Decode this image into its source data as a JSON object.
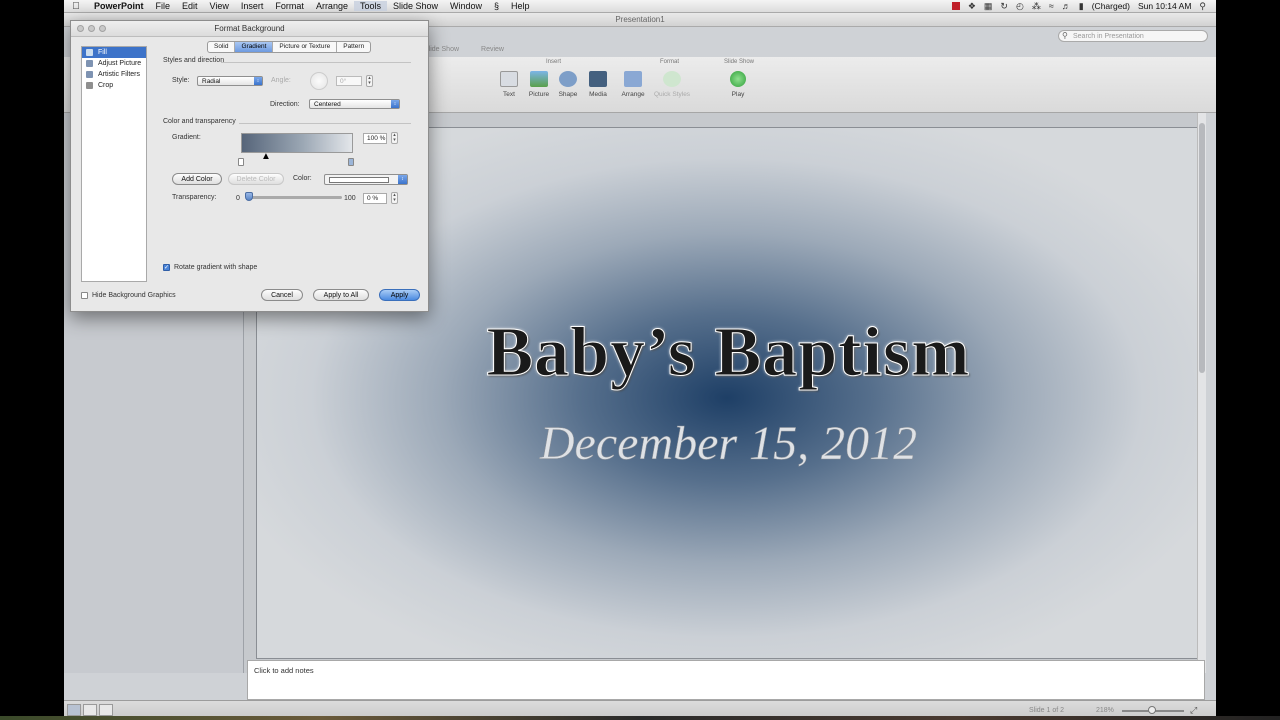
{
  "menubar": {
    "app": "PowerPoint",
    "items": [
      "File",
      "Edit",
      "View",
      "Insert",
      "Format",
      "Arrange",
      "Tools",
      "Slide Show",
      "Window",
      "Help"
    ],
    "selected": "Tools",
    "battery": "(Charged)",
    "clock": "Sun 10:14 AM"
  },
  "window": {
    "title": "Presentation1",
    "search_placeholder": "Search in Presentation",
    "ribbon_tabs": [
      "Slide Show",
      "Review"
    ],
    "groups": {
      "insert": "Insert",
      "format": "Format",
      "slideshow": "Slide Show"
    },
    "buttons": {
      "text": "Text",
      "picture": "Picture",
      "shape": "Shape",
      "media": "Media",
      "arrange": "Arrange",
      "quick_styles": "Quick Styles",
      "play": "Play"
    }
  },
  "slide": {
    "title": "Baby’s Baptism",
    "subtitle": "December 15, 2012",
    "gradient_center": "#1e3f66",
    "gradient_edge": "#d6d9dc"
  },
  "notes": {
    "placeholder": "Click to add notes"
  },
  "status": {
    "slide": "Slide 1 of 2",
    "zoom": "218%"
  },
  "dialog": {
    "title": "Format Background",
    "categories": [
      "Fill",
      "Adjust Picture",
      "Artistic Filters",
      "Crop"
    ],
    "selected_category": "Fill",
    "tabs": [
      "Solid",
      "Gradient",
      "Picture or Texture",
      "Pattern"
    ],
    "selected_tab": "Gradient",
    "styles_section": "Styles and direction",
    "style_label": "Style:",
    "style_value": "Radial",
    "angle_label": "Angle:",
    "angle_value": "0°",
    "direction_label": "Direction:",
    "direction_value": "Centered",
    "color_section": "Color and transparency",
    "gradient_label": "Gradient:",
    "gradient_percent": "100 %",
    "add_color": "Add Color",
    "delete_color": "Delete Color",
    "color_label": "Color:",
    "transparency_label": "Transparency:",
    "transparency_min": "0",
    "transparency_max": "100",
    "transparency_value": "0 %",
    "rotate_label": "Rotate gradient with shape",
    "rotate_checked": true,
    "hide_bg_label": "Hide Background Graphics",
    "hide_bg_checked": false,
    "cancel": "Cancel",
    "apply_all": "Apply to All",
    "apply": "Apply"
  }
}
